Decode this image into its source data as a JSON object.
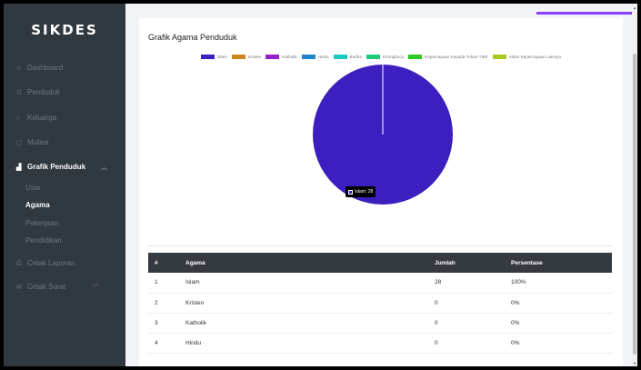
{
  "sidebar": {
    "brand": "SIKDES",
    "items": [
      {
        "label": "Dashboard",
        "icon": "dashboard-icon"
      },
      {
        "label": "Penduduk",
        "icon": "people-icon"
      },
      {
        "label": "Keluarga",
        "icon": "home-icon"
      },
      {
        "label": "Mutasi",
        "icon": "transfer-icon"
      },
      {
        "label": "Grafik Penduduk",
        "icon": "bar-chart-icon"
      },
      {
        "label": "Cetak Laporan",
        "icon": "print-icon"
      },
      {
        "label": "Cetak Surat",
        "icon": "mail-icon"
      }
    ],
    "subitems": [
      "Usia",
      "Agama",
      "Pekerjaan",
      "Pendidikan"
    ],
    "active_item": "Grafik Penduduk",
    "active_subitem": "Agama"
  },
  "card": {
    "title": "Grafik Agama Penduduk",
    "tooltip": "Islam: 28"
  },
  "chart_data": {
    "type": "pie",
    "categories": [
      "Islam",
      "Kristen",
      "Katholik",
      "Hindu",
      "Budha",
      "Khonghucu",
      "Kepercayaan Kepada Tuhan YME",
      "Aliran Kepercayaan Lainnya"
    ],
    "values": [
      28,
      0,
      0,
      0,
      0,
      0,
      0,
      0
    ],
    "colors": [
      "#3c1fbe",
      "#c9871e",
      "#9b1fc9",
      "#1f86c9",
      "#1fc9c2",
      "#1fc97e",
      "#2cc91f",
      "#a8c91f"
    ],
    "legend_position": "top"
  },
  "table": {
    "headers": [
      "#",
      "Agama",
      "Jumlah",
      "Persentase"
    ],
    "rows": [
      [
        "1",
        "Islam",
        "28",
        "100%"
      ],
      [
        "2",
        "Kristen",
        "0",
        "0%"
      ],
      [
        "3",
        "Katholik",
        "0",
        "0%"
      ],
      [
        "4",
        "Hindu",
        "0",
        "0%"
      ]
    ]
  },
  "colors": {
    "sidebar_bg": "#303840",
    "accent": "#8a3ffc",
    "table_header_bg": "#343a40"
  }
}
